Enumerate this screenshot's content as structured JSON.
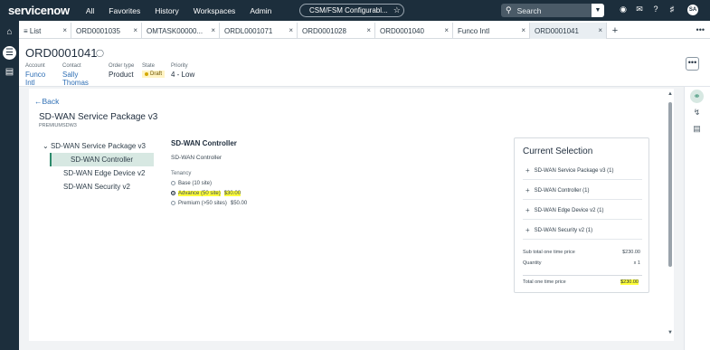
{
  "topbar": {
    "logo": "servicenow",
    "nav": [
      "All",
      "Favorites",
      "History",
      "Workspaces",
      "Admin"
    ],
    "app_pill": "CSM/FSM Configurabl...",
    "search_placeholder": "Search",
    "avatar_initials": "SA"
  },
  "tabs": [
    {
      "label": "≡ List",
      "closable": true
    },
    {
      "label": "ORD0001035",
      "closable": true
    },
    {
      "label": "OMTASK00000...",
      "closable": true
    },
    {
      "label": "ORDL0001071",
      "closable": true
    },
    {
      "label": "ORD0001028",
      "closable": true
    },
    {
      "label": "ORD0001040",
      "closable": true
    },
    {
      "label": "Funco Intl",
      "closable": true
    },
    {
      "label": "ORD0001041",
      "closable": true,
      "active": true
    }
  ],
  "record": {
    "number": "ORD0001041",
    "fields": [
      {
        "label": "Account",
        "value": "Funco Intl",
        "link": true
      },
      {
        "label": "Contact",
        "value": "Sally Thomas",
        "link": true
      },
      {
        "label": "Order type",
        "value": "Product",
        "link": false
      },
      {
        "label": "State",
        "value": "Draft",
        "link": false
      },
      {
        "label": "Priority",
        "value": "4 - Low",
        "link": false
      }
    ]
  },
  "configurator": {
    "back_label": "Back",
    "package_title": "SD-WAN Service Package v3",
    "package_code": "PREMIUMSDW3",
    "tree": {
      "root": "SD-WAN Service Package v3",
      "children": [
        "SD-WAN Controller",
        "SD-WAN Edge Device v2",
        "SD-WAN Security v2"
      ],
      "selected_index": 0
    },
    "detail": {
      "title": "SD-WAN Controller",
      "subtitle": "SD-WAN Controller",
      "tenancy_label": "Tenancy",
      "options": [
        {
          "label": "Base (10 site)",
          "price": "",
          "selected": false
        },
        {
          "label": "Advance (50 site)",
          "price": "$30.00",
          "selected": true
        },
        {
          "label": "Premium (>50 sites)",
          "price": "$50.00",
          "selected": false
        }
      ]
    },
    "selection": {
      "title": "Current Selection",
      "items": [
        "SD-WAN Service Package v3 (1)",
        "SD-WAN Controller (1)",
        "SD-WAN Edge Device v2 (1)",
        "SD-WAN Security v2 (1)"
      ],
      "subtotal_label": "Sub total one time price",
      "subtotal_value": "$230.00",
      "quantity_label": "Quantity",
      "quantity_value": "x 1",
      "total_label": "Total one time price",
      "total_value": "$230.00"
    }
  },
  "colors": {
    "topbar": "#1c2e3c",
    "link": "#2f6fb5",
    "accent": "#2d8a6b",
    "highlight": "#ffff3a"
  }
}
